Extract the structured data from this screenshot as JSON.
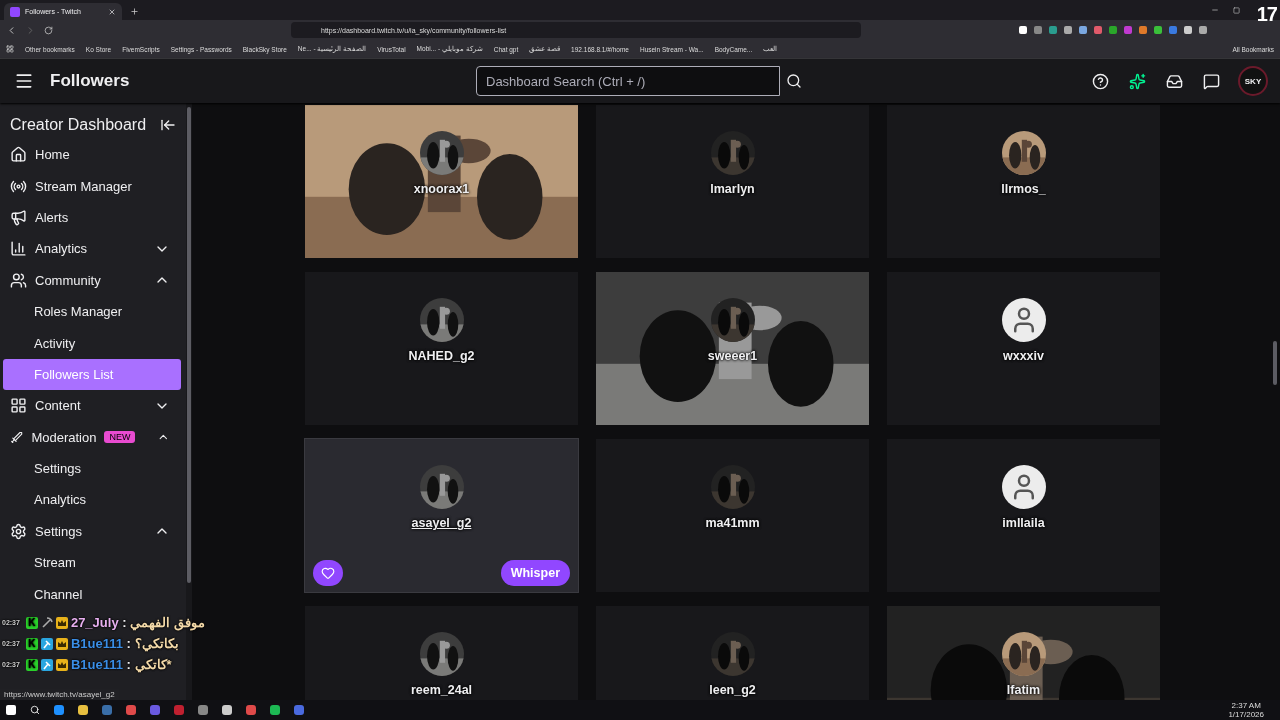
{
  "browser": {
    "tab": {
      "title": "Followers - Twitch",
      "selected": true
    },
    "url": "https://dashboard.twitch.tv/u/ia_sky/community/followers-list",
    "bookmarks": [
      "Other bookmarks",
      "Ko Store",
      "FivemScripts",
      "Settings - Passwords",
      "BlackSky Store",
      "Ne... - الصفحة الرئيسية",
      "VirusTotal",
      "Mobi... - شركة موبايلي",
      "Chat gpt",
      "قصة عشق",
      "192.168.8.1/#/home",
      "Husein Stream - Wa...",
      "BodyCame...",
      "العب"
    ],
    "all_bookmarks": "All Bookmarks",
    "status_url": "https://www.twitch.tv/asayel_g2"
  },
  "overlay_number": "17",
  "header": {
    "title": "Followers",
    "search": {
      "placeholder": "Dashboard Search (Ctrl + /)"
    },
    "avatar": "SKY"
  },
  "sidebar": {
    "title": "Creator Dashboard",
    "items": [
      {
        "label": "Home",
        "selected": false
      },
      {
        "label": "Stream Manager",
        "selected": false
      },
      {
        "label": "Alerts",
        "selected": false
      },
      {
        "label": "Analytics",
        "selected": false,
        "expanded": false
      },
      {
        "label": "Community",
        "selected": false,
        "expanded": true,
        "children": [
          {
            "label": "Roles Manager",
            "selected": false
          },
          {
            "label": "Activity",
            "selected": false
          },
          {
            "label": "Followers List",
            "selected": true
          }
        ]
      },
      {
        "label": "Content",
        "selected": false,
        "expanded": false
      },
      {
        "label": "Moderation",
        "selected": false,
        "expanded": true,
        "badge": "NEW",
        "children": [
          {
            "label": "Settings",
            "selected": false
          },
          {
            "label": "Analytics",
            "selected": false
          }
        ]
      },
      {
        "label": "Settings",
        "selected": false,
        "expanded": true,
        "children": [
          {
            "label": "Stream",
            "selected": false
          },
          {
            "label": "Channel",
            "selected": false
          }
        ]
      }
    ]
  },
  "followers": [
    {
      "name": "xnoorax1",
      "photo_avatar": true,
      "photo_background": true,
      "hovered": false
    },
    {
      "name": "lmarlyn",
      "photo_avatar": true,
      "photo_background": false,
      "hovered": false
    },
    {
      "name": "llrmos_",
      "photo_avatar": true,
      "photo_background": false,
      "hovered": false
    },
    {
      "name": "NAHED_g2",
      "photo_avatar": true,
      "photo_background": false,
      "hovered": false
    },
    {
      "name": "sweeer1",
      "photo_avatar": true,
      "photo_background": true,
      "hovered": false
    },
    {
      "name": "wxxxiv",
      "photo_avatar": false,
      "photo_background": false,
      "hovered": false
    },
    {
      "name": "asayel_g2",
      "photo_avatar": true,
      "photo_background": false,
      "hovered": true,
      "whisper": "Whisper"
    },
    {
      "name": "ma41mm",
      "photo_avatar": true,
      "photo_background": false,
      "hovered": false
    },
    {
      "name": "imllaila",
      "photo_avatar": false,
      "photo_background": false,
      "hovered": false
    },
    {
      "name": "reem_24al",
      "photo_avatar": true,
      "photo_background": false,
      "hovered": false
    },
    {
      "name": "leen_g2",
      "photo_avatar": true,
      "photo_background": false,
      "hovered": false
    },
    {
      "name": "lfatim",
      "photo_avatar": true,
      "photo_background": true,
      "hovered": false
    }
  ],
  "chat": [
    {
      "time": "02:37",
      "badges": [
        {
          "kind": "letter",
          "text": "K"
        },
        {
          "kind": "tool"
        },
        {
          "kind": "crown"
        }
      ],
      "user": "27_July",
      "separator": ":",
      "color": "#e8b0f0",
      "message": "موفق الفهمي"
    },
    {
      "time": "02:37",
      "badges": [
        {
          "kind": "letter",
          "text": "K"
        },
        {
          "kind": "mod"
        },
        {
          "kind": "crown"
        }
      ],
      "user": "B1ue111",
      "separator": ":",
      "color": "#3a8ee6",
      "message": "بكاتكي؟"
    },
    {
      "time": "02:37",
      "badges": [
        {
          "kind": "letter",
          "text": "K"
        },
        {
          "kind": "mod"
        },
        {
          "kind": "crown"
        }
      ],
      "user": "B1ue111",
      "separator": ":",
      "color": "#3a8ee6",
      "message": "*كاتكي"
    }
  ],
  "taskbar": {
    "time": "2:37 AM",
    "date": "1/17/2026"
  }
}
